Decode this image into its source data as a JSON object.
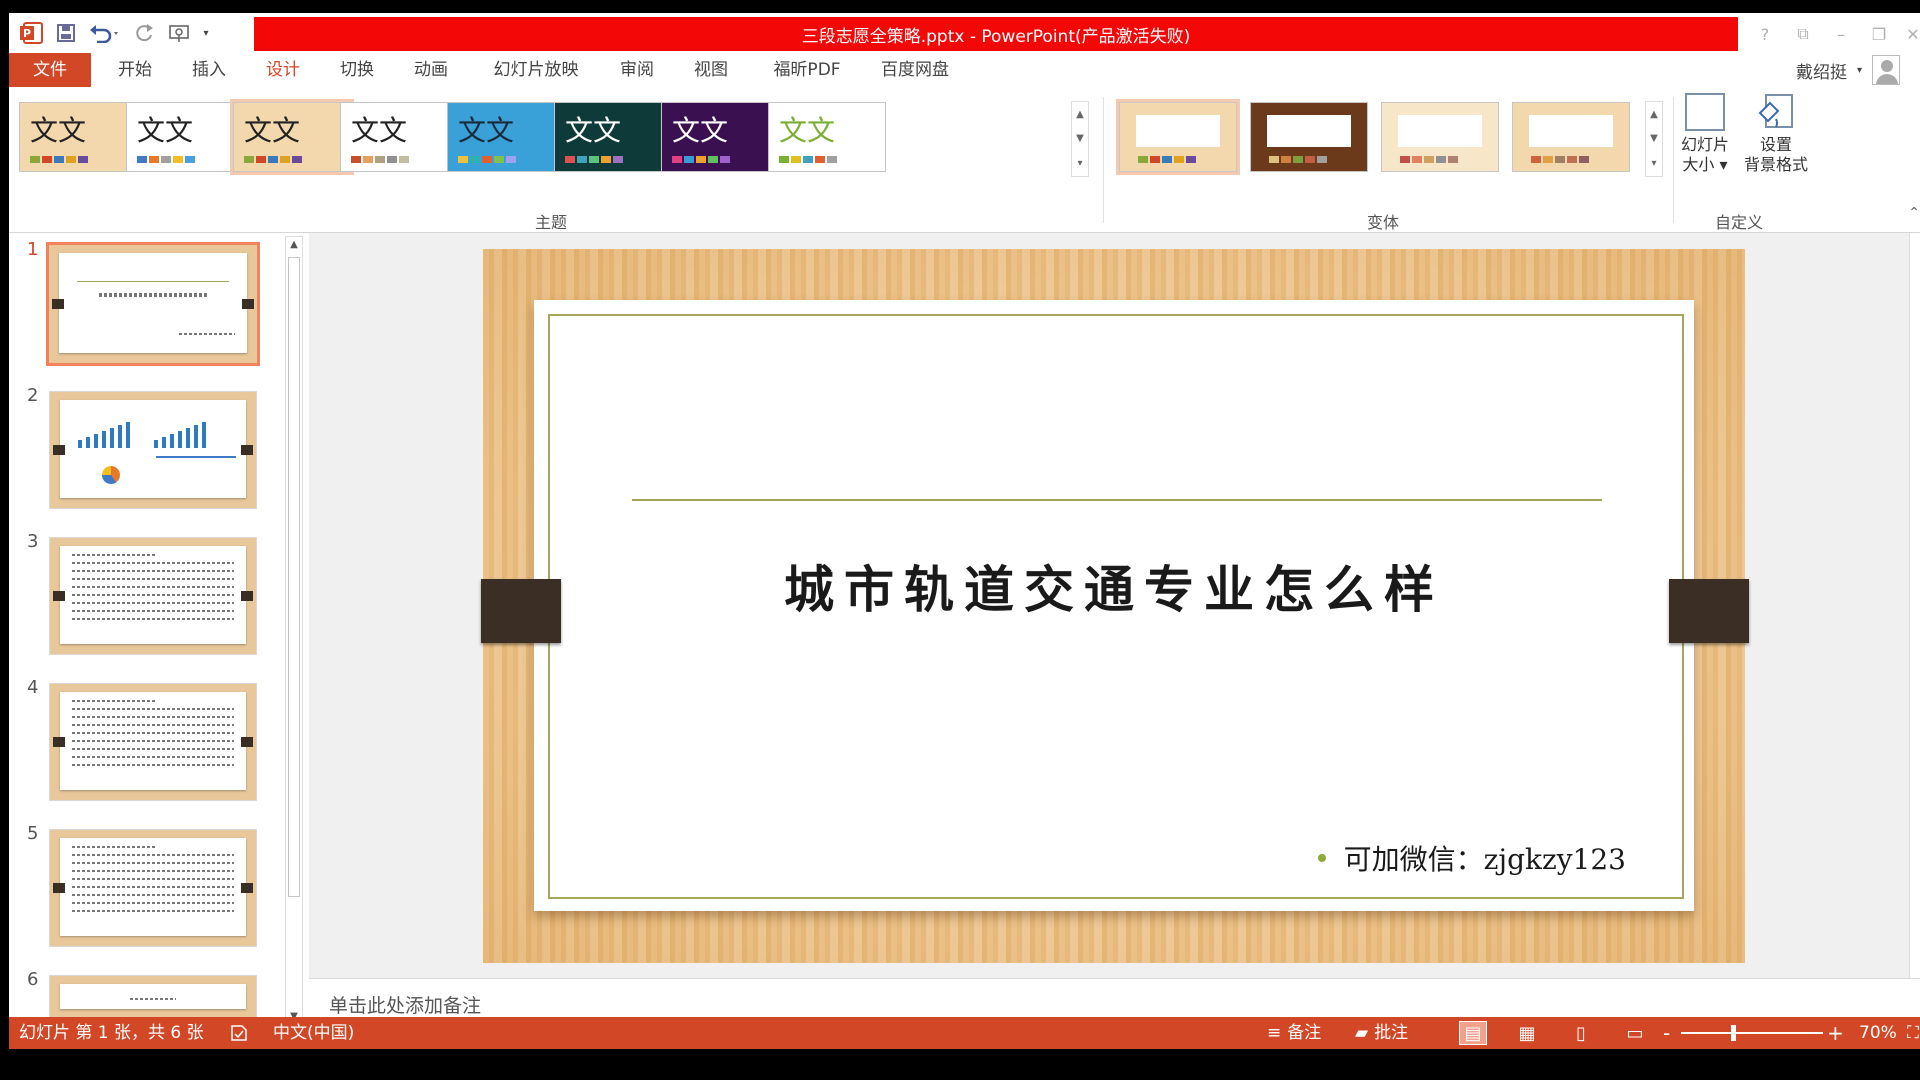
{
  "window": {
    "title": "三段志愿全策略.pptx -  PowerPoint(产品激活失败)",
    "controls": [
      "?",
      "⧉",
      "–",
      "❐",
      "✕"
    ]
  },
  "qat": {
    "app_icon": "powerpoint-icon",
    "icons": [
      "save-icon",
      "undo-icon",
      "redo-icon",
      "touch-mode-icon",
      "customize-icon"
    ]
  },
  "ribbon_tabs": [
    "文件",
    "开始",
    "插入",
    "设计",
    "切换",
    "动画",
    "幻灯片放映",
    "审阅",
    "视图",
    "福昕PDF",
    "百度网盘"
  ],
  "active_tab": "设计",
  "user": {
    "name": "戴绍挺"
  },
  "themes": {
    "label": "主题",
    "items": [
      {
        "text": "文文",
        "bg": "#f3d7ad",
        "fg": "#222222",
        "bars": [
          "#8aa83a",
          "#d24726",
          "#3a7ab8",
          "#e0a020",
          "#6a4a9a"
        ]
      },
      {
        "text": "文文",
        "bg": "#ffffff",
        "fg": "#222222",
        "bars": [
          "#3f7ac6",
          "#e8792a",
          "#a0a0a0",
          "#f0c020",
          "#4aa0d8"
        ]
      },
      {
        "text": "文文",
        "bg": "#f3d7ad",
        "fg": "#222222",
        "bars": [
          "#8aa83a",
          "#d24726",
          "#3a7ab8",
          "#e0a020",
          "#6a4a9a"
        ]
      },
      {
        "text": "文文",
        "bg": "#ffffff",
        "fg": "#222222",
        "bars": [
          "#c8502a",
          "#e8a060",
          "#b0a080",
          "#909090",
          "#c0c0a0"
        ]
      },
      {
        "text": "文文",
        "bg": "#3aa0d8",
        "fg": "#1b2a3a",
        "bars": [
          "#f0c040",
          "#30b0b0",
          "#e06030",
          "#80c050",
          "#a0a0f0"
        ]
      },
      {
        "text": "文文",
        "bg": "#0f3a3a",
        "fg": "#ffffff",
        "bars": [
          "#e05050",
          "#40a0c0",
          "#60c080",
          "#f0a030",
          "#a070c0"
        ]
      },
      {
        "text": "文文",
        "bg": "#3a1050",
        "fg": "#ffffff",
        "bars": [
          "#e04080",
          "#3a9ad8",
          "#f0a030",
          "#60c060",
          "#a060d0"
        ]
      },
      {
        "text": "文文",
        "bg": "#ffffff",
        "fg": "#7ab030",
        "bars": [
          "#7ab030",
          "#e0c020",
          "#40a0c0",
          "#e06030",
          "#a0a0a0"
        ]
      }
    ]
  },
  "variants": {
    "label": "变体",
    "items": [
      {
        "bg": "#f3d7ad",
        "bars": [
          "#8aa83a",
          "#d24726",
          "#3a7ab8",
          "#e0a020",
          "#6a4a9a"
        ]
      },
      {
        "bg": "#6a3a1a",
        "bars": [
          "#e0c080",
          "#d08040",
          "#80a040",
          "#c06040",
          "#a0a0a0"
        ]
      },
      {
        "bg": "#f8e6c8",
        "bars": [
          "#c0504a",
          "#e08060",
          "#d0a060",
          "#909090",
          "#b08070"
        ]
      },
      {
        "bg": "#f3d7ad",
        "bars": [
          "#d06040",
          "#e0a040",
          "#a08060",
          "#c07050",
          "#906060"
        ]
      }
    ]
  },
  "customize": {
    "label": "自定义",
    "slide_size_line1": "幻灯片",
    "slide_size_line2": "大小",
    "bg_format_line1": "设置",
    "bg_format_line2": "背景格式"
  },
  "slides": [
    {
      "num": "1",
      "kind": "title"
    },
    {
      "num": "2",
      "kind": "chart"
    },
    {
      "num": "3",
      "kind": "text"
    },
    {
      "num": "4",
      "kind": "text"
    },
    {
      "num": "5",
      "kind": "text"
    },
    {
      "num": "6",
      "kind": "partial"
    }
  ],
  "slide": {
    "title": "城市轨道交通专业怎么样",
    "bullet": "可加微信：zjgkzy123"
  },
  "notes_placeholder": "单击此处添加备注",
  "status": {
    "slide_info": "幻灯片 第 1 张，共 6 张",
    "language": "中文(中国)",
    "notes": "备注",
    "comments": "批注",
    "zoom": "70%",
    "zoom_minus": "-",
    "zoom_plus": "+"
  }
}
